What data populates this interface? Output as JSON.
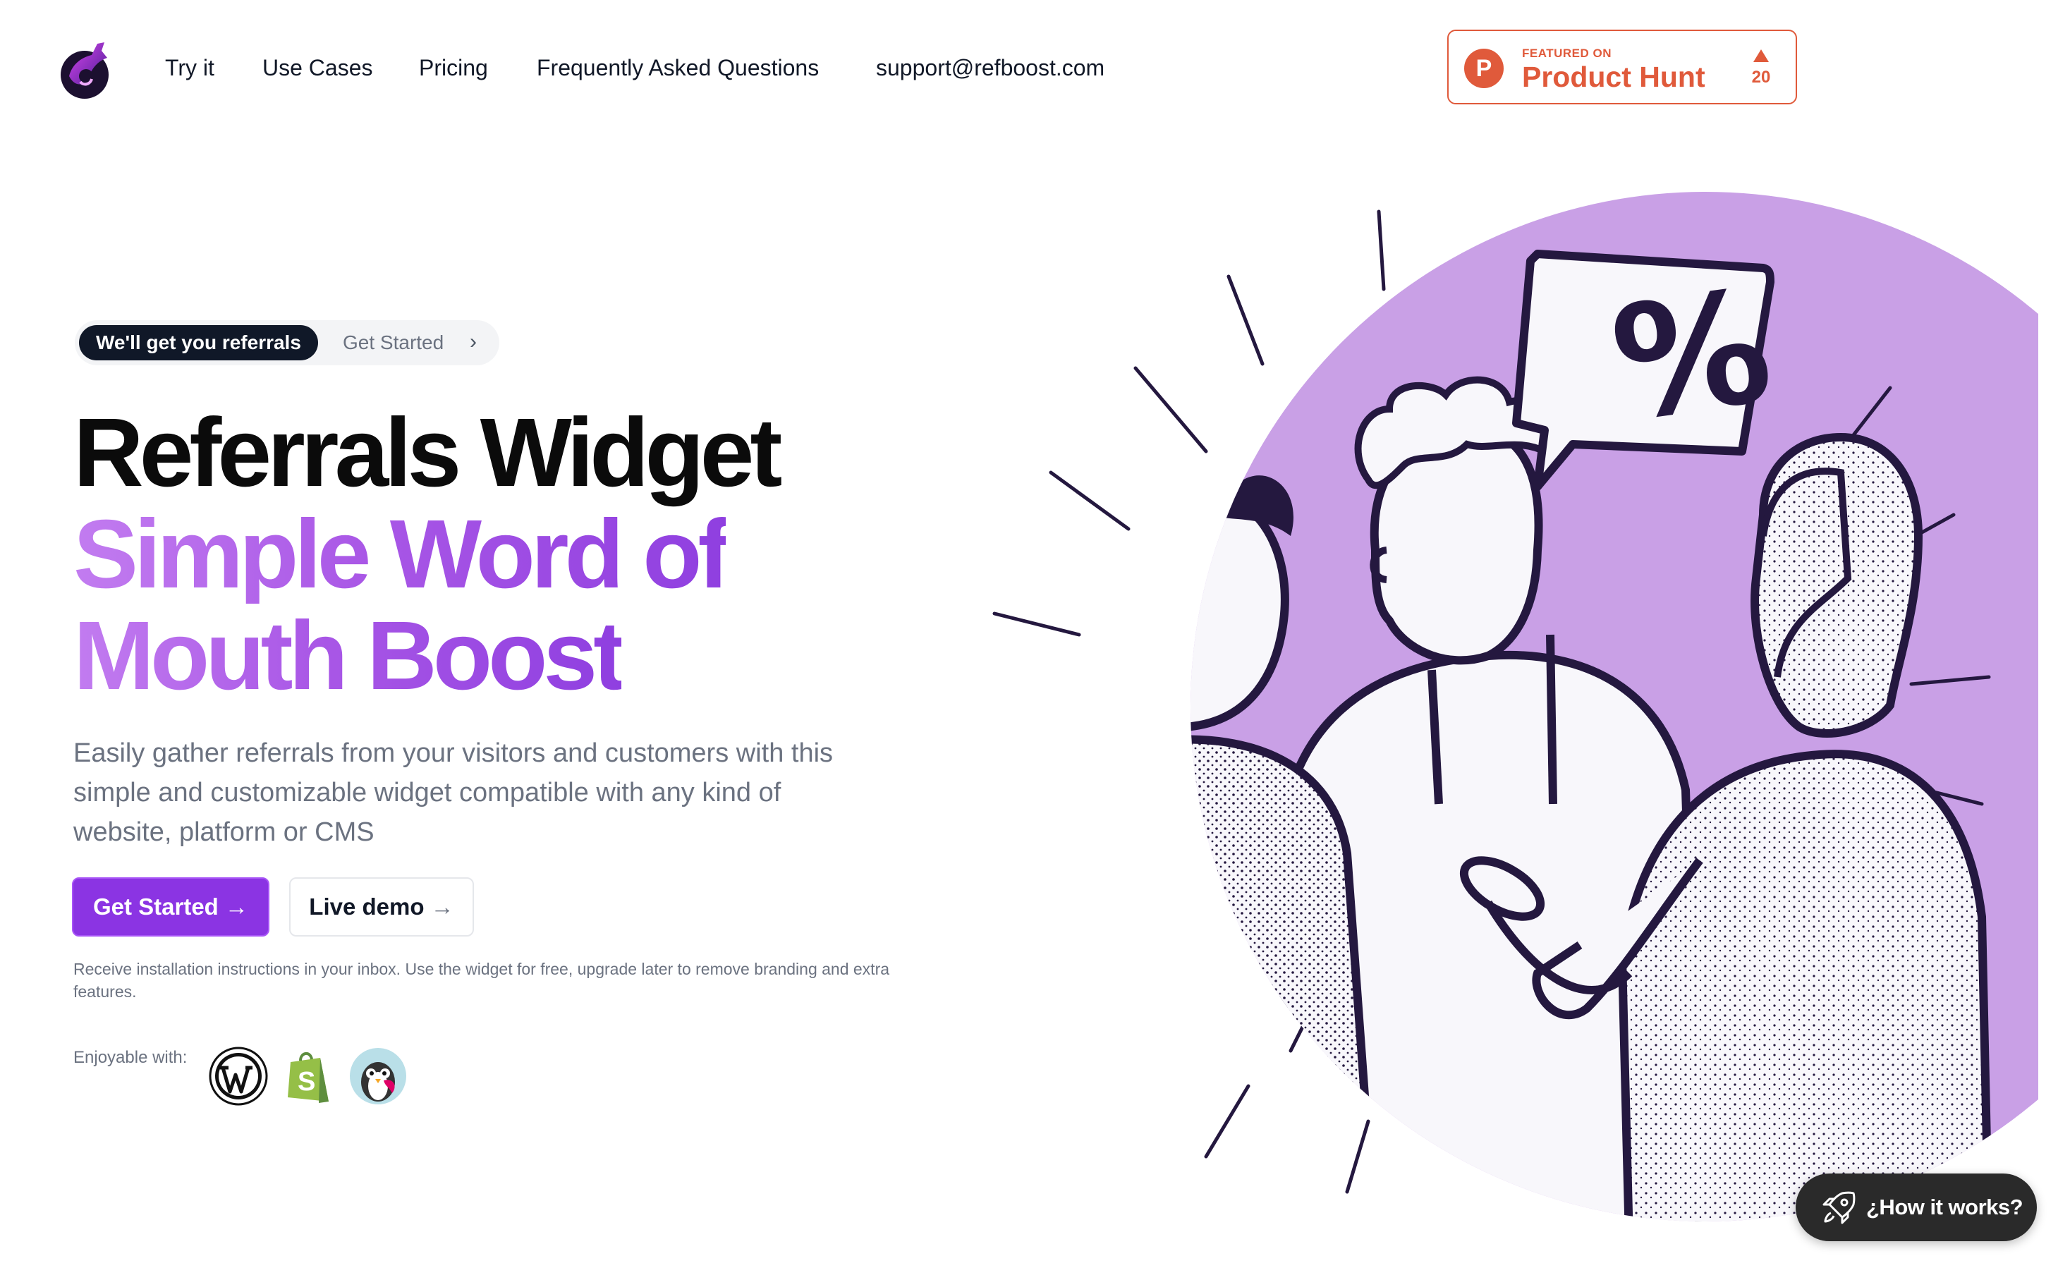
{
  "header": {
    "logo_icon": "rocket-logo-icon",
    "nav": [
      "Try it",
      "Use Cases",
      "Pricing",
      "Frequently Asked Questions",
      "support@refboost.com"
    ],
    "product_hunt": {
      "letter": "P",
      "featured": "FEATURED ON",
      "name": "Product Hunt",
      "upvotes": "20",
      "color": "#e05a3b"
    }
  },
  "hero": {
    "pill": {
      "tag": "We'll get you referrals",
      "link": "Get Started",
      "chevron": "›"
    },
    "title_line1": "Referrals Widget",
    "title_line2": "Simple Word of",
    "title_line3": "Mouth Boost",
    "description": "Easily gather referrals from your visitors and customers with this simple and customizable widget compatible with any kind of website, platform or CMS",
    "primary_button": "Get Started →",
    "secondary_button": "Live demo",
    "secondary_arrow": "→",
    "note": "Receive installation instructions in your inbox. Use the widget for free, upgrade later to remove branding and extra features.",
    "enjoy_label": "Enjoyable with:",
    "platforms": [
      "wordpress-icon",
      "shopify-icon",
      "prestashop-icon"
    ],
    "accent": "#8b34e3"
  },
  "illustration": {
    "description_icon": "people-talking-illustration",
    "bubble_text": "%",
    "circle_color": "#c9a0e6",
    "ink_color": "#24183f"
  },
  "floating": {
    "label": "¿How it works?",
    "icon": "rocket-icon"
  }
}
